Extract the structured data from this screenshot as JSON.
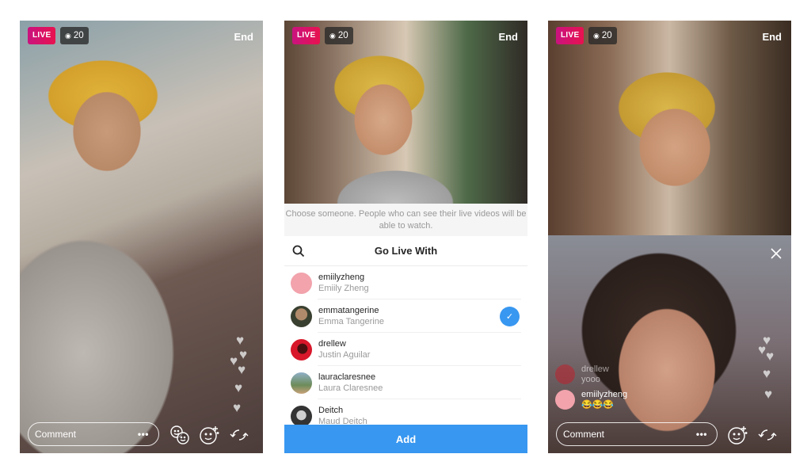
{
  "screens": [
    {
      "live_label": "LIVE",
      "viewer_icon": "eye-icon",
      "viewer_count": "20",
      "end_label": "End",
      "comment_placeholder": "Comment",
      "more_label": "•••",
      "icons": [
        "add-guest-icon",
        "face-filter-icon",
        "flip-camera-icon"
      ],
      "hearts_count": 6
    },
    {
      "live_label": "LIVE",
      "viewer_icon": "eye-icon",
      "viewer_count": "20",
      "end_label": "End",
      "hint": "Choose someone. People who can see their live videos will be able to watch.",
      "sheet_title": "Go Live With",
      "search_icon": "search-icon",
      "users": [
        {
          "username": "emiilyzheng",
          "name": "Emiily Zheng",
          "selected": false,
          "avatar_color": "#f2a3ac"
        },
        {
          "username": "emmatangerine",
          "name": "Emma Tangerine",
          "selected": true,
          "avatar_color": "#3a4030"
        },
        {
          "username": "drellew",
          "name": "Justin Aguilar",
          "selected": false,
          "avatar_color": "#d8172a"
        },
        {
          "username": "lauraclaresnee",
          "name": "Laura Claresnee",
          "selected": false,
          "avatar_color": "#8fb0c8"
        },
        {
          "username": "Deitch",
          "name": "Maud Deitch",
          "selected": false,
          "avatar_color": "#333333"
        }
      ],
      "check_glyph": "✓",
      "add_label": "Add"
    },
    {
      "live_label": "LIVE",
      "viewer_icon": "eye-icon",
      "viewer_count": "20",
      "end_label": "End",
      "close_icon": "close-icon",
      "comments": [
        {
          "username": "drellew",
          "text": "yooo",
          "avatar_color": "#c0202c",
          "faded": true
        },
        {
          "username": "emiilyzheng",
          "text": "😂😂😂",
          "avatar_color": "#f2a3ac",
          "faded": false
        }
      ],
      "comment_placeholder": "Comment",
      "more_label": "•••",
      "icons": [
        "face-filter-icon",
        "flip-camera-icon"
      ],
      "hearts_count": 5
    }
  ],
  "colors": {
    "live_gradient_start": "#c9137f",
    "live_gradient_end": "#e8124f",
    "accent_blue": "#3897f0"
  }
}
